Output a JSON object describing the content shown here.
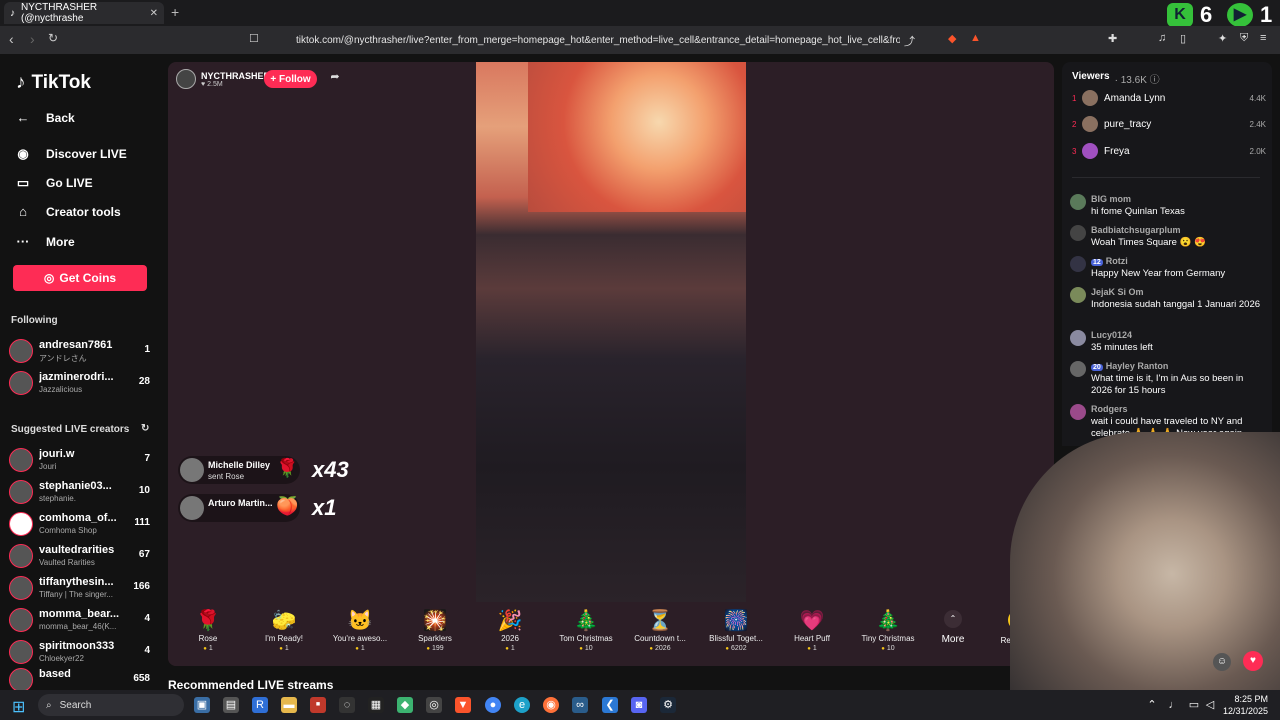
{
  "browser": {
    "tab_title": "NYCTHRASHER (@nycthrashe",
    "url": "tiktok.com/@nycthrasher/live?enter_from_merge=homepage_hot&enter_method=live_cell&entrance_detail=homepage_hot_live_cell&from_pla...",
    "overlay_numbers": [
      "6",
      "1"
    ]
  },
  "sidebar": {
    "brand": "TikTok",
    "menu": [
      {
        "label": "Back",
        "icon": "back-icon"
      },
      {
        "label": "Discover LIVE",
        "icon": "live-icon"
      },
      {
        "label": "Go LIVE",
        "icon": "camera-icon"
      },
      {
        "label": "Creator tools",
        "icon": "home-icon"
      },
      {
        "label": "More",
        "icon": "more-icon"
      }
    ],
    "get_coins": "Get Coins",
    "following_title": "Following",
    "following": [
      {
        "name": "andresan7861",
        "sub": "アンドレさん",
        "count": "1"
      },
      {
        "name": "jazminerodri...",
        "sub": "Jazzalicious",
        "count": "28"
      }
    ],
    "suggested_title": "Suggested LIVE creators",
    "suggested": [
      {
        "name": "jouri.w",
        "sub": "Jouri",
        "count": "7"
      },
      {
        "name": "stephanie03...",
        "sub": "stephanie.",
        "count": "10"
      },
      {
        "name": "comhoma_of...",
        "sub": "Comhoma Shop",
        "count": "111"
      },
      {
        "name": "vaultedrarities",
        "sub": "Vaulted Rarities",
        "count": "67"
      },
      {
        "name": "tiffanythesin...",
        "sub": "Tiffany | The singer...",
        "count": "166"
      },
      {
        "name": "momma_bear...",
        "sub": "momma_bear_46(K...",
        "count": "4"
      },
      {
        "name": "spiritmoon333",
        "sub": "Chloekyer22",
        "count": "4"
      },
      {
        "name": "based",
        "sub": "",
        "count": "658"
      }
    ]
  },
  "stream": {
    "host": "NYCTHRASHER",
    "likes": "2.5M",
    "follow": "+ Follow",
    "gift_alerts": [
      {
        "user": "Michelle Dilley",
        "action": "sent Rose",
        "multiplier": "x43"
      },
      {
        "user": "Arturo Martin...",
        "action": "",
        "multiplier": "x1"
      }
    ]
  },
  "gifts": [
    {
      "name": "Rose",
      "price": "1",
      "icon": "🌹"
    },
    {
      "name": "I'm Ready!",
      "price": "1",
      "icon": "🧽"
    },
    {
      "name": "You're aweso...",
      "price": "1",
      "icon": "🐱"
    },
    {
      "name": "Sparklers",
      "price": "199",
      "icon": "🎇"
    },
    {
      "name": "2026",
      "price": "1",
      "icon": "🎉"
    },
    {
      "name": "Tom Christmas",
      "price": "10",
      "icon": "🎄"
    },
    {
      "name": "Countdown t...",
      "price": "2026",
      "icon": "⏳"
    },
    {
      "name": "Blissful Toget...",
      "price": "6202",
      "icon": "🎆"
    },
    {
      "name": "Heart Puff",
      "price": "1",
      "icon": "💗"
    },
    {
      "name": "Tiny Christmas",
      "price": "10",
      "icon": "🎄"
    }
  ],
  "gift_more": "More",
  "recharge": "Recharge",
  "recommended": "Recommended LIVE streams",
  "viewers": {
    "title": "Viewers",
    "count": "13.6K",
    "top": [
      {
        "rank": "1",
        "name": "Amanda Lynn",
        "score": "4.4K"
      },
      {
        "rank": "2",
        "name": "pure_tracy",
        "score": "2.4K"
      },
      {
        "rank": "3",
        "name": "Freya",
        "score": "2.0K"
      }
    ]
  },
  "comments": [
    {
      "name": "BIG mom",
      "badge": "",
      "text": "hi fome Quinlan Texas"
    },
    {
      "name": "Badbiatchsugarplum",
      "badge": "",
      "text": "Woah Times Square 😮 😍"
    },
    {
      "name": "Rotzi",
      "badge": "12",
      "text": "Happy New Year from Germany"
    },
    {
      "name": "JejaK Si Om",
      "badge": "",
      "text": "Indonesia sudah tanggal 1 Januari 2026"
    },
    {
      "name": "Lucy0124",
      "badge": "",
      "text": "35 minutes left"
    },
    {
      "name": "Hayley Ranton",
      "badge": "20",
      "text": "What time is it, I'm in Aus so been in 2026 for 15 hours"
    },
    {
      "name": "Rodgers",
      "badge": "",
      "text": "wait i could have traveled to NY and celebrate 🙏 🙏 🙏 New year again"
    }
  ],
  "taskbar": {
    "search": "Search",
    "time": "8:25 PM",
    "date": "12/31/2025"
  },
  "colors": {
    "accent": "#fe2c55",
    "coin": "#f5c518"
  }
}
